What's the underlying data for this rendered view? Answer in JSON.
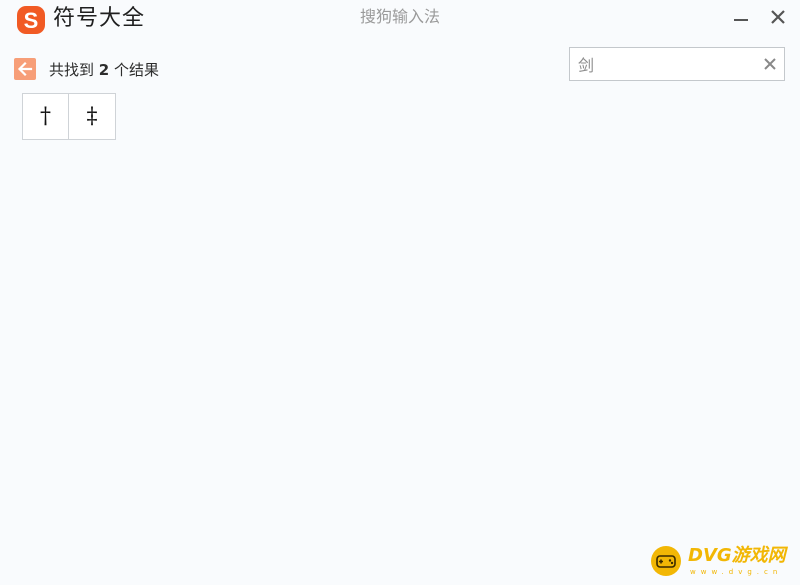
{
  "app": {
    "title": "符号大全",
    "window_title": "搜狗输入法",
    "logo_text": "S",
    "brand_color": "#f15a24"
  },
  "window_controls": {
    "minimize_icon": "minimize-icon",
    "close_icon": "close-icon"
  },
  "results": {
    "back_icon": "arrow-left-icon",
    "prefix": "共找到 ",
    "count": "2",
    "suffix": " 个结果",
    "symbols": [
      "†",
      "‡"
    ]
  },
  "search": {
    "value": "剑",
    "clear_icon": "clear-icon"
  },
  "watermark": {
    "text": "DVG游戏网",
    "sub": "www.dvg.cn",
    "color": "#f2b705"
  }
}
